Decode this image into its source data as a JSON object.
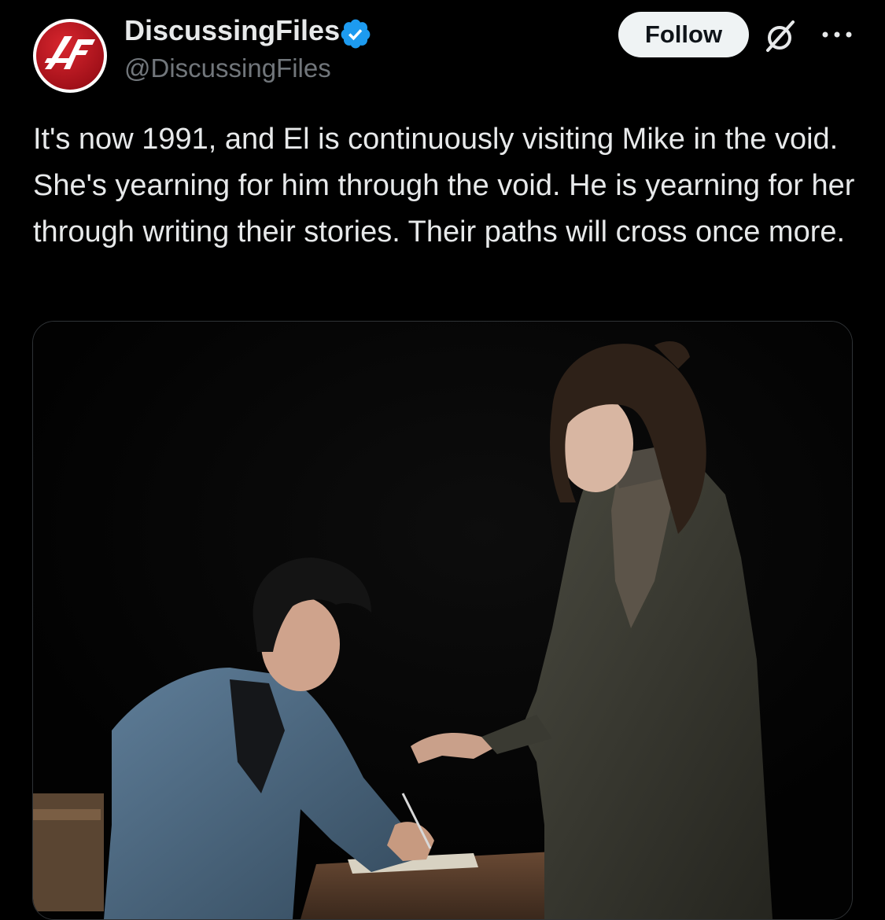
{
  "author": {
    "display_name": "DiscussingFiles",
    "handle": "@DiscussingFiles",
    "avatar_text": "4F",
    "verified": true
  },
  "actions": {
    "follow_label": "Follow"
  },
  "tweet": {
    "text": "It's now 1991, and El is continuously visiting Mike in the void. She's yearning for him through the void. He is yearning for her through writing their stories. Their paths will cross once more."
  },
  "colors": {
    "background": "#000000",
    "text_primary": "#e7e9ea",
    "text_secondary": "#71767b",
    "verified_blue": "#1d9bf0",
    "avatar_red": "#c8161e",
    "follow_bg": "#eff3f4"
  },
  "icons": {
    "verified": "verified-badge-icon",
    "grok": "grok-icon",
    "more": "more-options-icon"
  }
}
